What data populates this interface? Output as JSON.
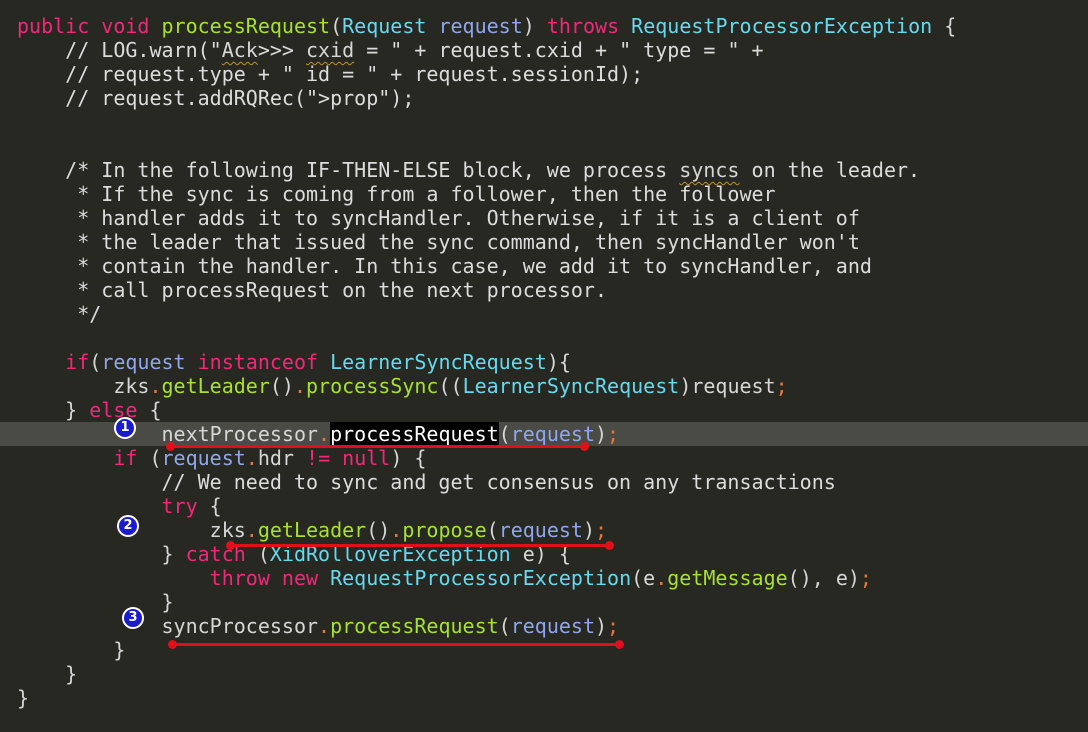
{
  "editor": {
    "highlighted_line": 18,
    "colors": {
      "background": "#272822",
      "keyword": "#f0287a",
      "method": "#a6e22e",
      "type": "#66d9ef",
      "variable": "#8fa6ee",
      "annotation": "#e0101a",
      "badge": "#1a1ad0"
    },
    "lines": [
      [
        [
          "k",
          "public "
        ],
        [
          "k",
          "void "
        ],
        [
          "m",
          "processRequest"
        ],
        [
          "p",
          "("
        ],
        [
          "t",
          "Request "
        ],
        [
          "v",
          "request"
        ],
        [
          "p",
          ") "
        ],
        [
          "k",
          "throws "
        ],
        [
          "t",
          "RequestProcessorException "
        ],
        [
          "p",
          "{"
        ]
      ],
      [
        [
          "c",
          "    // LOG.warn(\""
        ],
        [
          "u",
          "Ack"
        ],
        [
          "c",
          ">>> "
        ],
        [
          "u",
          "cxid"
        ],
        [
          "c",
          " = \" + request.cxid + \" type = \" +"
        ]
      ],
      [
        [
          "c",
          "    // request.type + \" id = \" + request.sessionId);"
        ]
      ],
      [
        [
          "c",
          "    // request.addRQRec(\">prop\");"
        ]
      ],
      [],
      [],
      [
        [
          "c",
          "    /* In the following IF-THEN-ELSE block, we process "
        ],
        [
          "u",
          "syncs"
        ],
        [
          "c",
          " on the leader."
        ]
      ],
      [
        [
          "c",
          "     * If the sync is coming from a follower, then the follower"
        ]
      ],
      [
        [
          "c",
          "     * handler adds it to syncHandler. Otherwise, if it is a client of"
        ]
      ],
      [
        [
          "c",
          "     * the leader that issued the sync command, then syncHandler won't"
        ]
      ],
      [
        [
          "c",
          "     * contain the handler. In this case, we add it to syncHandler, and"
        ]
      ],
      [
        [
          "c",
          "     * call processRequest on the next processor."
        ]
      ],
      [
        [
          "c",
          "     */"
        ]
      ],
      [],
      [
        [
          "p",
          "    "
        ],
        [
          "k",
          "if"
        ],
        [
          "p",
          "("
        ],
        [
          "v",
          "request "
        ],
        [
          "k",
          "instanceof "
        ],
        [
          "t",
          "LearnerSyncRequest"
        ],
        [
          "p",
          "){"
        ]
      ],
      [
        [
          "p",
          "        zks"
        ],
        [
          "o",
          "."
        ],
        [
          "m",
          "getLeader"
        ],
        [
          "p",
          "()"
        ],
        [
          "o",
          "."
        ],
        [
          "m",
          "processSync"
        ],
        [
          "p",
          "(("
        ],
        [
          "t",
          "LearnerSyncRequest"
        ],
        [
          "p",
          ")request"
        ],
        [
          "o",
          ";"
        ]
      ],
      [
        [
          "p",
          "    } "
        ],
        [
          "k",
          "else"
        ],
        [
          "p",
          " {"
        ]
      ],
      [
        [
          "p",
          "            nextProcessor"
        ],
        [
          "o",
          "."
        ],
        [
          "sel",
          "processRequest"
        ],
        [
          "p",
          "("
        ],
        [
          "v",
          "request"
        ],
        [
          "p",
          ")"
        ],
        [
          "o",
          ";"
        ]
      ],
      [
        [
          "p",
          "        "
        ],
        [
          "k",
          "if"
        ],
        [
          "p",
          " ("
        ],
        [
          "v",
          "request"
        ],
        [
          "o",
          "."
        ],
        [
          "p",
          "hdr "
        ],
        [
          "k",
          "!= null"
        ],
        [
          "p",
          ") {"
        ]
      ],
      [
        [
          "c",
          "            // We need to sync and get consensus on any transactions"
        ]
      ],
      [
        [
          "p",
          "            "
        ],
        [
          "k",
          "try"
        ],
        [
          "p",
          " {"
        ]
      ],
      [
        [
          "p",
          "                zks"
        ],
        [
          "o",
          "."
        ],
        [
          "m",
          "getLeader"
        ],
        [
          "p",
          "()"
        ],
        [
          "o",
          "."
        ],
        [
          "m",
          "propose"
        ],
        [
          "p",
          "("
        ],
        [
          "v",
          "request"
        ],
        [
          "p",
          ")"
        ],
        [
          "o",
          ";"
        ]
      ],
      [
        [
          "p",
          "            } "
        ],
        [
          "k",
          "catch"
        ],
        [
          "p",
          " ("
        ],
        [
          "t",
          "XidRolloverException"
        ],
        [
          "p",
          " e) {"
        ]
      ],
      [
        [
          "p",
          "                "
        ],
        [
          "k",
          "throw new "
        ],
        [
          "t",
          "RequestProcessorException"
        ],
        [
          "p",
          "(e"
        ],
        [
          "o",
          "."
        ],
        [
          "m",
          "getMessage"
        ],
        [
          "p",
          "(), e)"
        ],
        [
          "o",
          ";"
        ]
      ],
      [
        [
          "p",
          "            }"
        ]
      ],
      [
        [
          "p",
          "            syncProcessor"
        ],
        [
          "o",
          "."
        ],
        [
          "m",
          "processRequest"
        ],
        [
          "p",
          "("
        ],
        [
          "v",
          "request"
        ],
        [
          "p",
          ")"
        ],
        [
          "o",
          ";"
        ]
      ],
      [
        [
          "p",
          "        }"
        ]
      ],
      [
        [
          "p",
          "    }"
        ]
      ],
      [
        [
          "p",
          "}"
        ]
      ]
    ]
  },
  "annotations": [
    {
      "label": "1"
    },
    {
      "label": "2"
    },
    {
      "label": "3"
    }
  ]
}
